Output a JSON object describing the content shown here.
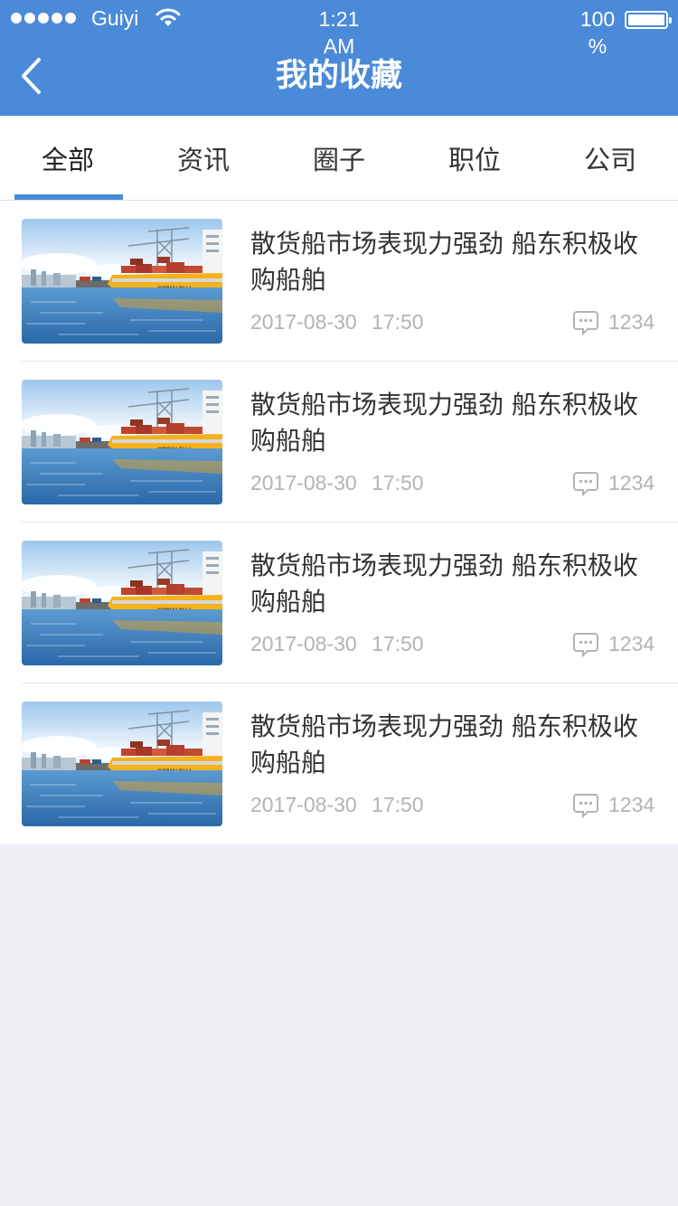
{
  "status_bar": {
    "carrier": "Guiyi",
    "time": "1:21 AM",
    "battery": "100 %"
  },
  "header": {
    "title": "我的收藏"
  },
  "tabs": [
    {
      "label": "全部",
      "active": true
    },
    {
      "label": "资讯",
      "active": false
    },
    {
      "label": "圈子",
      "active": false
    },
    {
      "label": "职位",
      "active": false
    },
    {
      "label": "公司",
      "active": false
    }
  ],
  "items": [
    {
      "title": "散货船市场表现力强劲 船东积极收购船舶",
      "date": "2017-08-30",
      "time": "17:50",
      "comments": "1234",
      "ship_label": "GRIMALDI LI"
    },
    {
      "title": "散货船市场表现力强劲 船东积极收购船舶",
      "date": "2017-08-30",
      "time": "17:50",
      "comments": "1234",
      "ship_label": "GRIMALDI LI"
    },
    {
      "title": "散货船市场表现力强劲 船东积极收购船舶",
      "date": "2017-08-30",
      "time": "17:50",
      "comments": "1234",
      "ship_label": "GRIMALDI LI"
    },
    {
      "title": "散货船市场表现力强劲 船东积极收购船舶",
      "date": "2017-08-30",
      "time": "17:50",
      "comments": "1234",
      "ship_label": "GRIMALDI LI"
    }
  ],
  "colors": {
    "accent": "#4a8ad9",
    "background": "#eef0f5",
    "meta_text": "#b3b3b3",
    "ship_hull": "#f5b21b"
  },
  "icons": {
    "back": "chevron-left-icon",
    "wifi": "wifi-icon",
    "battery": "battery-icon",
    "comment": "comment-bubble-icon"
  }
}
